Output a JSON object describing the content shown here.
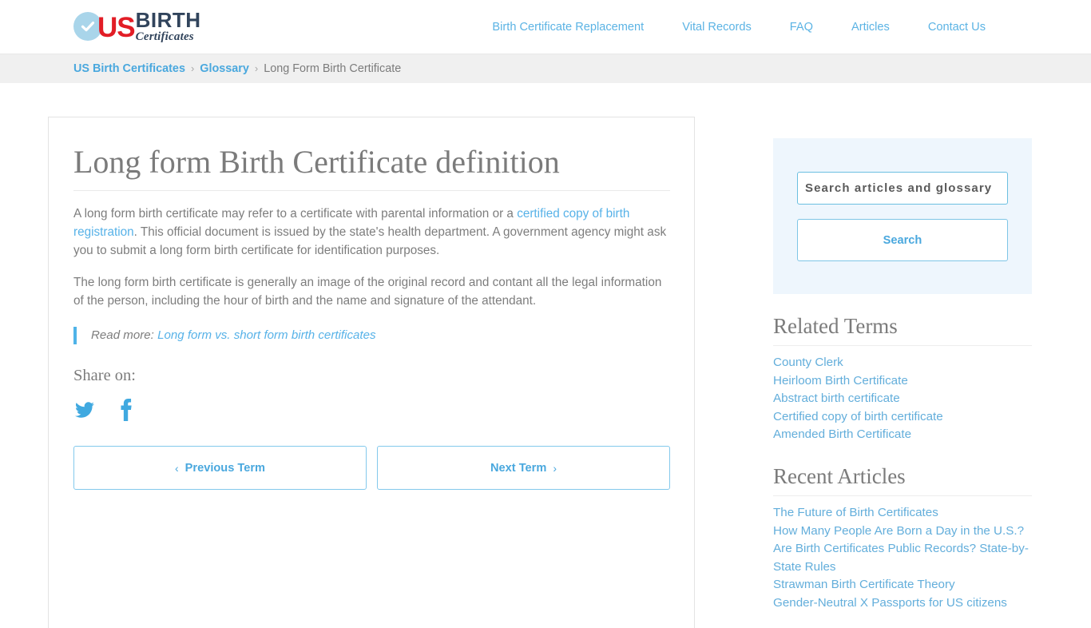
{
  "header": {
    "logo": {
      "badge_icon": "check-circle-icon",
      "us": "US",
      "birth": "BIRTH",
      "certificates": "Certificates",
      "badge_color": "#a9d5ea",
      "us_color": "#e21d26",
      "text_color": "#31445c"
    },
    "nav": [
      {
        "label": "Birth Certificate Replacement"
      },
      {
        "label": "Vital Records"
      },
      {
        "label": "FAQ"
      },
      {
        "label": "Articles"
      },
      {
        "label": "Contact Us"
      }
    ],
    "nav_color": "#5bb3e4"
  },
  "breadcrumb": {
    "items": [
      {
        "label": "US Birth Certificates",
        "link": true
      },
      {
        "label": "Glossary",
        "link": true
      },
      {
        "label": "Long Form Birth Certificate",
        "link": false
      }
    ],
    "separator": "›",
    "link_color": "#4aa8de",
    "current_color": "#7c7c7c",
    "background": "#f0f0f0"
  },
  "main": {
    "title": "Long form Birth Certificate definition",
    "paragraph1": {
      "before": "A long form birth certificate may refer to a certificate with parental information or a ",
      "link": "certified copy of birth registration",
      "after": ". This official document is issued by the state's health department. A government agency might ask you to submit a long form birth certificate for identification purposes."
    },
    "paragraph2": "The long form birth certificate is generally an image of the original record and contant all the legal information of the person, including the hour of birth and the name and signature of the attendant.",
    "readmore": {
      "prefix": "Read more: ",
      "link": "Long form vs. short form birth certificates",
      "accent": "#4fb3e8"
    },
    "share": {
      "label": "Share on:",
      "links": [
        {
          "icon": "twitter-icon",
          "name": "Twitter"
        },
        {
          "icon": "facebook-icon",
          "name": "Facebook"
        }
      ],
      "icon_color": "#40a9e0"
    },
    "term_nav": {
      "prev_chevron": "‹",
      "prev_label": "Previous Term",
      "next_label": "Next Term",
      "next_chevron": "›"
    }
  },
  "sidebar": {
    "search": {
      "placeholder": "Search articles and glossary",
      "value": "",
      "button_label": "Search",
      "panel_background": "#eef6fd"
    },
    "related_terms": {
      "heading": "Related Terms",
      "items": [
        {
          "label": "County Clerk"
        },
        {
          "label": "Heirloom Birth Certificate"
        },
        {
          "label": "Abstract birth certificate"
        },
        {
          "label": "Certified copy of birth certificate"
        },
        {
          "label": "Amended Birth Certificate"
        }
      ]
    },
    "recent_articles": {
      "heading": "Recent Articles",
      "items": [
        {
          "label": "The Future of Birth Certificates"
        },
        {
          "label": "How Many People Are Born a Day in the U.S.?"
        },
        {
          "label": "Are Birth Certificates Public Records? State-by-State Rules"
        },
        {
          "label": "Strawman Birth Certificate Theory"
        },
        {
          "label": "Gender-Neutral X Passports for US citizens"
        }
      ]
    },
    "link_color": "#63aedb"
  }
}
